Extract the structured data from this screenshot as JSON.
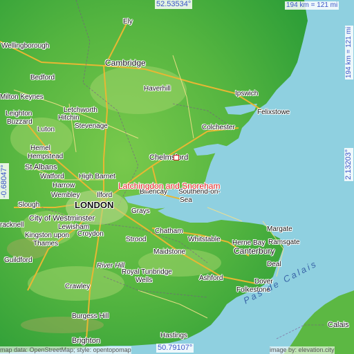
{
  "map": {
    "place": "Latchingdon and Snoreham",
    "coords": {
      "top": "52.53534°",
      "bottom": "50.79107°",
      "left": "-0.68047°",
      "right": "2.13203°"
    },
    "scale": {
      "horizontal": "194 km = 121 mi",
      "vertical": "194 km = 121 mi"
    },
    "sea_label": "Pas de Calais",
    "attribution_left": "map data: OpenStreetMap; style: opentopomap",
    "attribution_right": "image by: elevation.city",
    "cities": {
      "london": "LONDON",
      "westminster": "City of Westminster",
      "cambridge": "Cambridge",
      "chelmsford": "Chelmsford",
      "canterbury": "Canterbury",
      "st_albans": "St Albans",
      "brighton": "Brighton",
      "calais": "Calais"
    },
    "towns": {
      "ely": "Ely",
      "wellingborough": "Wellingborough",
      "bedford": "Bedford",
      "milton_keynes": "Milton Keynes",
      "leighton": "Leighton",
      "buzzard": "Buzzard",
      "letchworth": "Letchworth",
      "hitchin": "Hitchin",
      "stevenage": "Stevenage",
      "luton": "Luton",
      "haverhill": "Haverhill",
      "ipswich": "Ipswich",
      "felixstowe": "Felixstowe",
      "colchester": "Colchester",
      "hemel": "Hemel",
      "hempstead": "Hempstead",
      "watford": "Watford",
      "harrow": "Harrow",
      "high_barnet": "High Barnet",
      "ilford": "Ilford",
      "billericay": "Billericay",
      "southend": "Southend-on-",
      "sea": "Sea",
      "wembley": "Wembley",
      "slough": "Slough",
      "grays": "Grays",
      "lewisham": "Lewisham",
      "crackne": "racknell",
      "kingston": "Kingston upon",
      "thames": "Thames",
      "croydon": "Croydon",
      "chatham": "Chatham",
      "strood": "Strood",
      "maidstone": "Maidstone",
      "herne_bay": "Herne Bay",
      "margate": "Margate",
      "ramsgate": "Ramsgate",
      "whitstable": "Whitstable",
      "deal": "Deal",
      "dover": "Dover",
      "folkestone": "Folkestone",
      "ashford": "Ashford",
      "royal_tunbridge": "Royal Tunbridge",
      "wells": "Wells",
      "guildford": "Guildford",
      "crawley": "Crawley",
      "burgess_hill": "Burgess Hill",
      "hastings": "Hastings",
      "river_hill": "River Hill"
    },
    "colors": {
      "sea": "#8fd0e0",
      "land_low": "#35a83a",
      "land_mid": "#6fc24a",
      "marker": "#d01c1c",
      "label_red": "#e02020",
      "coord_blue": "#3a55c8"
    }
  }
}
